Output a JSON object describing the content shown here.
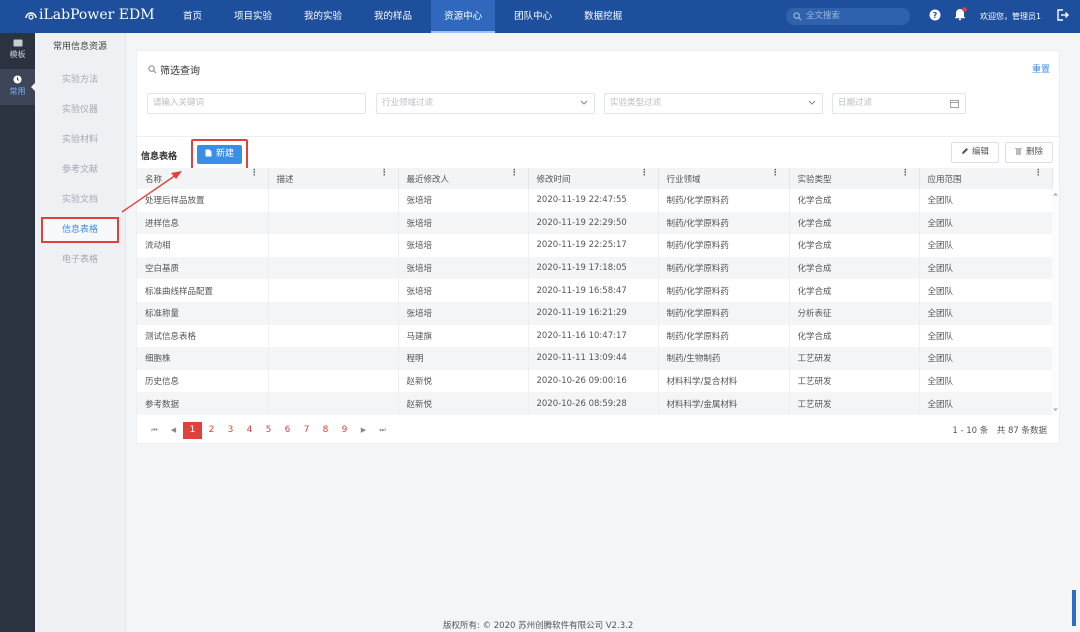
{
  "app": {
    "logo": "iLabPower EDM"
  },
  "nav": {
    "items": [
      {
        "label": "首页"
      },
      {
        "label": "项目实验"
      },
      {
        "label": "我的实验"
      },
      {
        "label": "我的样品"
      },
      {
        "label": "资源中心",
        "active": true
      },
      {
        "label": "团队中心"
      },
      {
        "label": "数据挖掘"
      }
    ]
  },
  "search": {
    "placeholder": "全文搜索"
  },
  "user": {
    "welcome": "欢迎您，管理员1"
  },
  "rail": {
    "items": [
      {
        "label": "模板"
      },
      {
        "label": "常用"
      }
    ]
  },
  "submenu": {
    "title": "常用信息资源",
    "items": [
      "实验方法",
      "实验仪器",
      "实验材料",
      "参考文献",
      "实验文档",
      "信息表格",
      "电子表格"
    ]
  },
  "filter": {
    "title": "筛选查询",
    "reset": "重置",
    "keyword_placeholder": "请输入关键词",
    "industry_placeholder": "行业领域过滤",
    "type_placeholder": "实验类型过滤",
    "date_placeholder": "日期过滤"
  },
  "table": {
    "title": "信息表格",
    "new_label": "新建",
    "edit_label": "编辑",
    "delete_label": "删除",
    "columns": [
      "名称",
      "描述",
      "最近修改人",
      "修改时间",
      "行业领域",
      "实验类型",
      "应用范围"
    ],
    "rows": [
      [
        "处理后样品放置",
        "",
        "张培培",
        "2020-11-19 22:47:55",
        "制药/化学原料药",
        "化学合成",
        "全团队"
      ],
      [
        "进样信息",
        "",
        "张培培",
        "2020-11-19 22:29:50",
        "制药/化学原料药",
        "化学合成",
        "全团队"
      ],
      [
        "流动相",
        "",
        "张培培",
        "2020-11-19 22:25:17",
        "制药/化学原料药",
        "化学合成",
        "全团队"
      ],
      [
        "空白基质",
        "",
        "张培培",
        "2020-11-19 17:18:05",
        "制药/化学原料药",
        "化学合成",
        "全团队"
      ],
      [
        "标准曲线样品配置",
        "",
        "张培培",
        "2020-11-19 16:58:47",
        "制药/化学原料药",
        "化学合成",
        "全团队"
      ],
      [
        "标准称量",
        "",
        "张培培",
        "2020-11-19 16:21:29",
        "制药/化学原料药",
        "分析表征",
        "全团队"
      ],
      [
        "测试信息表格",
        "",
        "马建旗",
        "2020-11-16 10:47:17",
        "制药/化学原料药",
        "化学合成",
        "全团队"
      ],
      [
        "细胞株",
        "",
        "程明",
        "2020-11-11 13:09:44",
        "制药/生物制药",
        "工艺研发",
        "全团队"
      ],
      [
        "历史信息",
        "",
        "赵新悦",
        "2020-10-26 09:00:16",
        "材料科学/复合材料",
        "工艺研发",
        "全团队"
      ],
      [
        "参考数据",
        "",
        "赵新悦",
        "2020-10-26 08:59:28",
        "材料科学/金属材料",
        "工艺研发",
        "全团队"
      ]
    ]
  },
  "pager": {
    "pages": [
      "1",
      "2",
      "3",
      "4",
      "5",
      "6",
      "7",
      "8",
      "9"
    ],
    "current": "1",
    "summary": "1 - 10 条　共 87 条数据"
  },
  "footer": {
    "text": "版权所有: © 2020 苏州创腾软件有限公司  V2.3.2"
  },
  "colors": {
    "header_bg": "#1d4f9c",
    "accent": "#3a8ee6",
    "annotation_red": "#e1413b"
  }
}
